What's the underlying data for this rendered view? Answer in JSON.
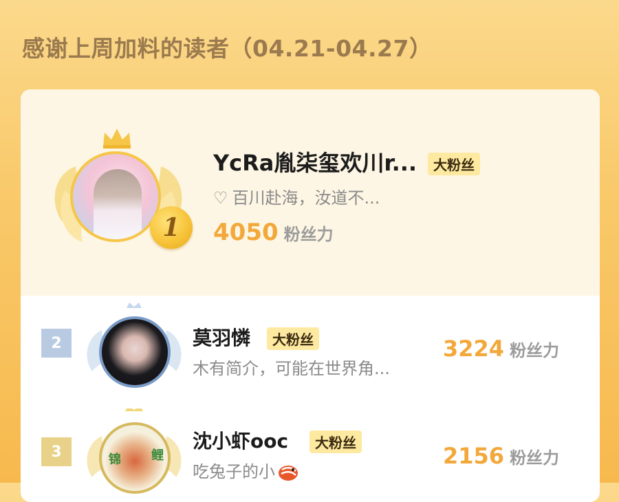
{
  "title": "感谢上周加料的读者（04.21-04.27）",
  "top_reader": {
    "rank": "1",
    "name": "YcRa胤柒玺欢川r...",
    "badge": "大粉丝",
    "bio": "百川赴海，汝道不...",
    "score": "4050",
    "score_unit": "粉丝力"
  },
  "readers": [
    {
      "rank": "2",
      "name": "莫羽憐",
      "badge": "大粉丝",
      "bio": "木有简介，可能在世界角...",
      "score": "3224",
      "score_unit": "粉丝力"
    },
    {
      "rank": "3",
      "name": "沈小虾ooc",
      "badge": "大粉丝",
      "bio": "吃兔子的小",
      "score": "2156",
      "score_unit": "粉丝力",
      "avatar_text": [
        "锦",
        "鲤"
      ]
    }
  ],
  "colors": {
    "background": "#f9c96a",
    "title": "#9a7a4e",
    "score": "#f2a83a",
    "badge_bg": "#fde9a0",
    "gold_ring": "#f6c648",
    "silver_ring": "#7a9bc6"
  },
  "icons": [
    "crown-icon",
    "wing-icon",
    "medal-icon",
    "heart-icon",
    "rank-flag-icon",
    "shrimp-icon"
  ]
}
